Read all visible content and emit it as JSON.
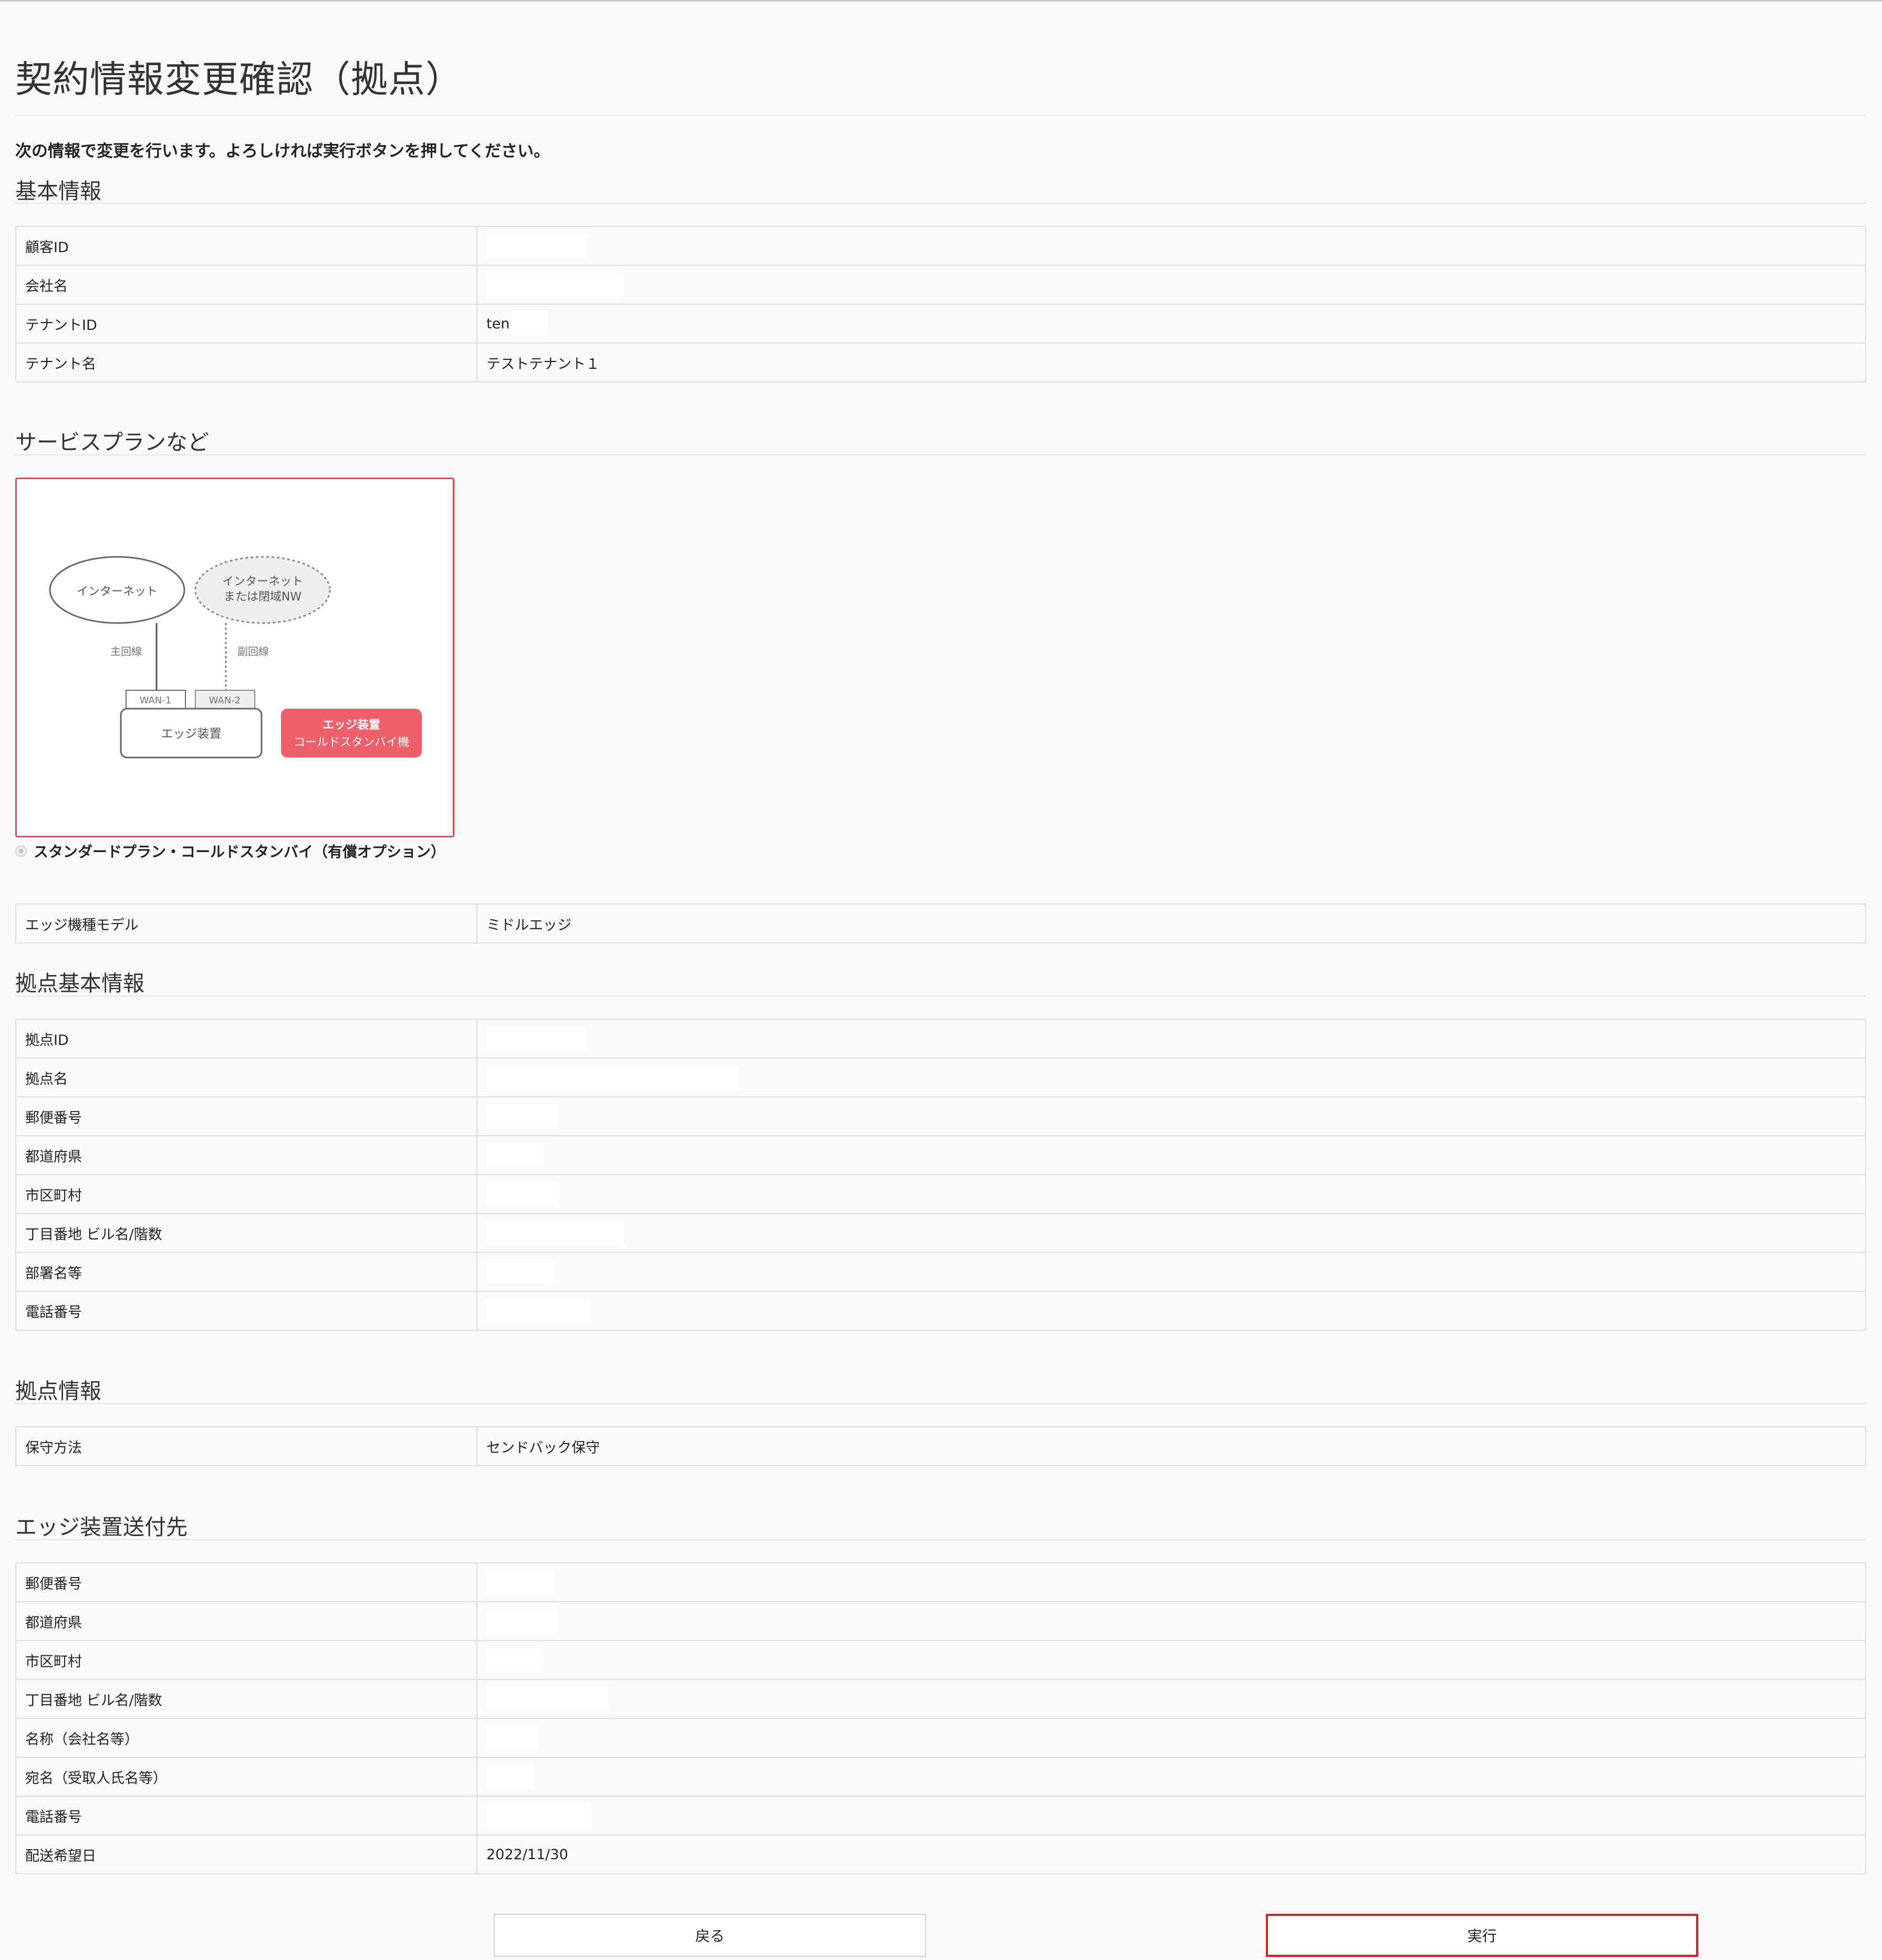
{
  "page": {
    "title": "契約情報変更確認（拠点）",
    "lead": "次の情報で変更を行います。よろしければ実行ボタンを押してください。"
  },
  "basic": {
    "heading": "基本情報",
    "rows": [
      {
        "label": "顧客ID",
        "value": ""
      },
      {
        "label": "会社名",
        "value": ""
      },
      {
        "label": "テナントID",
        "value": "ten"
      },
      {
        "label": "テナント名",
        "value": "テストテナント１"
      }
    ]
  },
  "service": {
    "heading": "サービスプランなど",
    "diagram": {
      "internet": "インターネット",
      "internet_or_closed_1": "インターネット",
      "internet_or_closed_2": "または閉域NW",
      "main_line": "主回線",
      "sub_line": "副回線",
      "wan1": "WAN-1",
      "wan2": "WAN-2",
      "edge": "エッジ装置",
      "standby_1": "エッジ装置",
      "standby_2": "コールドスタンバイ機"
    },
    "plan_label": "スタンダードプラン・コールドスタンバイ（有償オプション）",
    "rows": [
      {
        "label": "エッジ機種モデル",
        "value": "ミドルエッジ"
      }
    ]
  },
  "site_basic": {
    "heading": "拠点基本情報",
    "rows": [
      {
        "label": "拠点ID",
        "value": ""
      },
      {
        "label": "拠点名",
        "value": ""
      },
      {
        "label": "郵便番号",
        "value": ""
      },
      {
        "label": "都道府県",
        "value": ""
      },
      {
        "label": "市区町村",
        "value": ""
      },
      {
        "label": "丁目番地 ビル名/階数",
        "value": ""
      },
      {
        "label": "部署名等",
        "value": ""
      },
      {
        "label": "電話番号",
        "value": ""
      }
    ]
  },
  "site_info": {
    "heading": "拠点情報",
    "rows": [
      {
        "label": "保守方法",
        "value": "センドバック保守"
      }
    ]
  },
  "shipping": {
    "heading": "エッジ装置送付先",
    "rows": [
      {
        "label": "郵便番号",
        "value": ""
      },
      {
        "label": "都道府県",
        "value": ""
      },
      {
        "label": "市区町村",
        "value": ""
      },
      {
        "label": "丁目番地 ビル名/階数",
        "value": ""
      },
      {
        "label": "名称（会社名等）",
        "value": ""
      },
      {
        "label": "宛名（受取人氏名等）",
        "value": ""
      },
      {
        "label": "電話番号",
        "value": ""
      },
      {
        "label": "配送希望日",
        "value": "2022/11/30"
      }
    ]
  },
  "buttons": {
    "back": "戻る",
    "exec": "実行"
  },
  "colors": {
    "accent_red": "#d81f26",
    "standby_box": "#f0606b",
    "background": "#faf9fc"
  }
}
